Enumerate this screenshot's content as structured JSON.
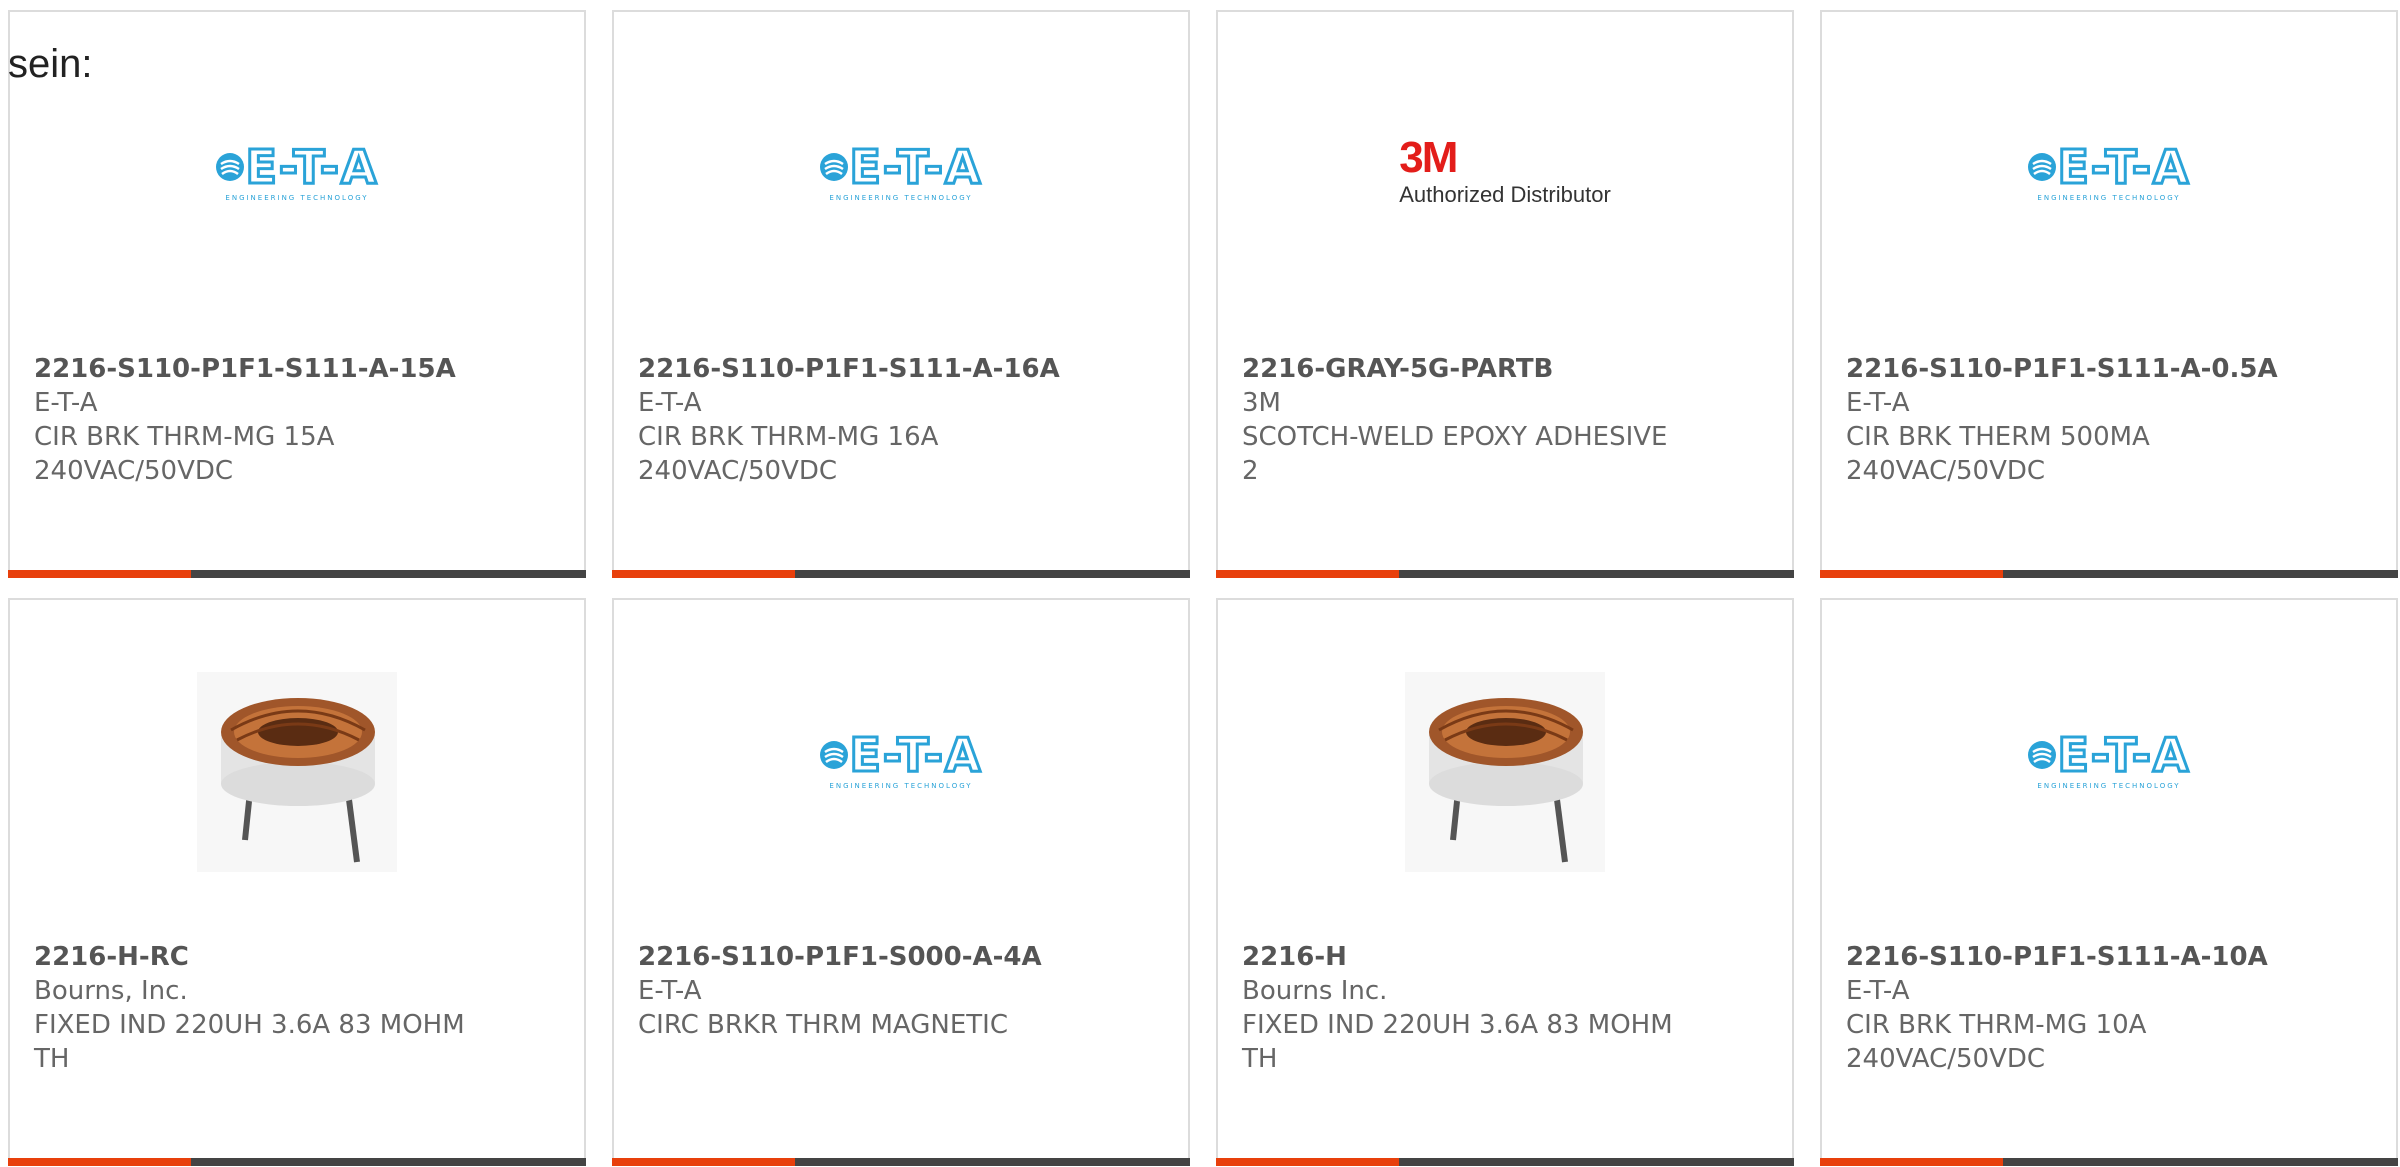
{
  "intro_text": "sein:",
  "colors": {
    "accent_bar": "#e8400c",
    "bar": "#444444",
    "eta_blue": "#2aa3d8",
    "m3_red": "#e31d1a"
  },
  "products": [
    {
      "part_number": "2216-S110-P1F1-S111-A-15A",
      "manufacturer": "E-T-A",
      "description": "CIR BRK THRM-MG 15A 240VAC/50VDC",
      "image": "eta-logo",
      "logo_text": "E-T-A",
      "logo_subtext": "ENGINEERING TECHNOLOGY"
    },
    {
      "part_number": "2216-S110-P1F1-S111-A-16A",
      "manufacturer": "E-T-A",
      "description": "CIR BRK THRM-MG 16A 240VAC/50VDC",
      "image": "eta-logo",
      "logo_text": "E-T-A",
      "logo_subtext": "ENGINEERING TECHNOLOGY"
    },
    {
      "part_number": "2216-GRAY-5G-PARTB",
      "manufacturer": "3M",
      "description": "SCOTCH-WELD EPOXY ADHESIVE 2",
      "image": "3m-logo",
      "logo_text": "3M",
      "logo_subtext": "Authorized Distributor"
    },
    {
      "part_number": "2216-S110-P1F1-S111-A-0.5A",
      "manufacturer": "E-T-A",
      "description": "CIR BRK THERM 500MA 240VAC/50VDC",
      "image": "eta-logo",
      "logo_text": "E-T-A",
      "logo_subtext": "ENGINEERING TECHNOLOGY"
    },
    {
      "part_number": "2216-H-RC",
      "manufacturer": "Bourns, Inc.",
      "description": "FIXED IND 220UH 3.6A 83 MOHM TH",
      "image": "toroidal-inductor-photo"
    },
    {
      "part_number": "2216-S110-P1F1-S000-A-4A",
      "manufacturer": "E-T-A",
      "description": "CIRC BRKR THRM MAGNETIC",
      "image": "eta-logo",
      "logo_text": "E-T-A",
      "logo_subtext": "ENGINEERING TECHNOLOGY"
    },
    {
      "part_number": "2216-H",
      "manufacturer": "Bourns Inc.",
      "description": "FIXED IND 220UH 3.6A 83 MOHM TH",
      "image": "toroidal-inductor-photo"
    },
    {
      "part_number": "2216-S110-P1F1-S111-A-10A",
      "manufacturer": "E-T-A",
      "description": "CIR BRK THRM-MG 10A 240VAC/50VDC",
      "image": "eta-logo",
      "logo_text": "E-T-A",
      "logo_subtext": "ENGINEERING TECHNOLOGY"
    }
  ]
}
